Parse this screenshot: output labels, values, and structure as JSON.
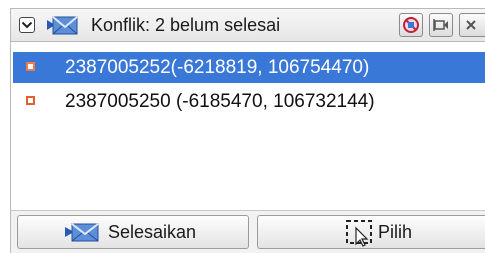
{
  "header": {
    "title": "Konflik: 2 belum selesai",
    "collapse_icon": "collapse-toggle-icon",
    "panel_icon": "envelope-conflict-icon",
    "buttons": [
      {
        "name": "cancel-icon"
      },
      {
        "name": "dock-icon"
      },
      {
        "name": "close-icon"
      }
    ]
  },
  "conflicts": [
    {
      "label": "2387005252(-6218819, 106754470)",
      "selected": true
    },
    {
      "label": "2387005250 (-6185470, 106732144)",
      "selected": false
    }
  ],
  "actions": {
    "resolve_label": "Selesaikan",
    "select_label": "Pilih"
  },
  "colors": {
    "selection": "#3a78d8",
    "node_marker": "#e06030"
  }
}
